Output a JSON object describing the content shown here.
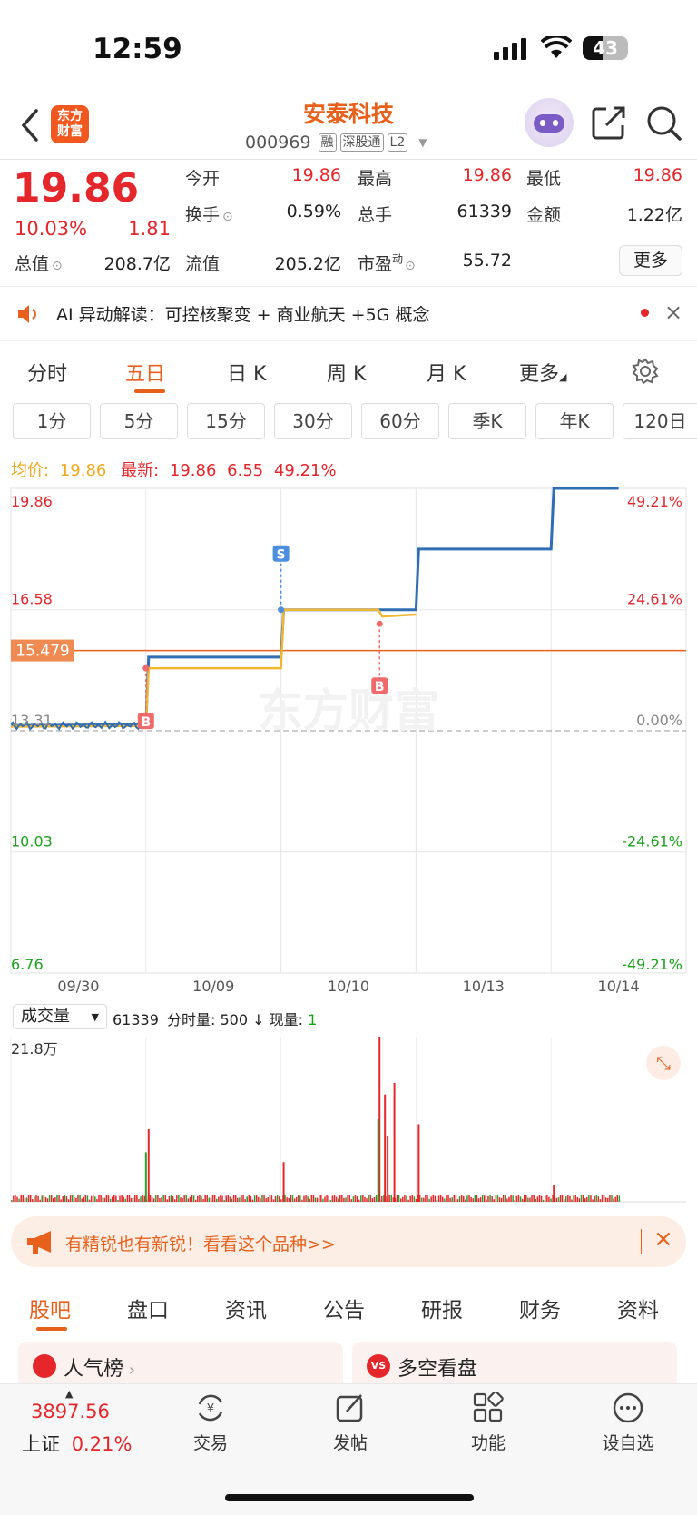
{
  "status_bar": {
    "time": "12:59",
    "battery": "43"
  },
  "header": {
    "logo_line1": "东方",
    "logo_line2": "财富",
    "title": "安泰科技",
    "code": "000969",
    "tags": [
      "融",
      "深股通",
      "L2"
    ]
  },
  "quote": {
    "price": "19.86",
    "change_pct": "10.03%",
    "change": "1.81",
    "fields": [
      {
        "label": "今开",
        "value": "19.86"
      },
      {
        "label": "最高",
        "value": "19.86"
      },
      {
        "label": "最低",
        "value": "19.86"
      },
      {
        "label": "换手",
        "value": "0.59%"
      },
      {
        "label": "总手",
        "value": "61339"
      },
      {
        "label": "金额",
        "value": "1.22亿"
      },
      {
        "label": "总值",
        "value": "208.7亿"
      },
      {
        "label": "流值",
        "value": "205.2亿"
      },
      {
        "label": "市盈",
        "sup": "动",
        "value": "55.72"
      }
    ],
    "more_button": "更多"
  },
  "ai_bar": {
    "text": "AI 异动解读：可控核聚变 + 商业航天 +5G 概念"
  },
  "period_tabs": [
    "分时",
    "五日",
    "日 K",
    "周 K",
    "月 K",
    "更多"
  ],
  "active_period": "五日",
  "sub_tabs": [
    "1分",
    "5分",
    "15分",
    "30分",
    "60分",
    "季K",
    "年K",
    "120日"
  ],
  "chart_info": {
    "avg_label": "均价:",
    "avg_value": "19.86",
    "latest_label": "最新:",
    "latest_price": "19.86",
    "latest_change": "6.55",
    "latest_pct": "49.21%"
  },
  "chart_data": {
    "type": "line",
    "title": "",
    "x": [
      "09/30",
      "10/09",
      "10/10",
      "10/13",
      "10/14"
    ],
    "y_left_ticks": [
      "19.86",
      "16.58",
      "13.31",
      "10.03",
      "6.76"
    ],
    "y_right_ticks": [
      "49.21%",
      "24.61%",
      "0.00%",
      "-24.61%",
      "-49.21%"
    ],
    "ylim": [
      6.76,
      19.86
    ],
    "reference_price": 13.31,
    "marker_line": {
      "label": "15.479",
      "value": 15.479
    },
    "series": [
      {
        "name": "价格",
        "color": "#2f6db5",
        "values": [
          [
            0,
            13.45
          ],
          [
            1,
            13.48
          ],
          [
            1.02,
            15.3
          ],
          [
            2,
            15.3
          ],
          [
            2.02,
            16.58
          ],
          [
            3,
            16.58
          ],
          [
            3.02,
            18.22
          ],
          [
            4,
            18.22
          ],
          [
            4.02,
            19.86
          ],
          [
            4.5,
            19.86
          ]
        ]
      },
      {
        "name": "均价",
        "color": "#f2b731",
        "values": [
          [
            0,
            13.42
          ],
          [
            1,
            13.44
          ],
          [
            1.02,
            15.0
          ],
          [
            2,
            15.0
          ],
          [
            2.02,
            16.58
          ],
          [
            2.72,
            16.58
          ],
          [
            2.75,
            16.4
          ],
          [
            3,
            16.45
          ]
        ]
      }
    ],
    "trade_markers": [
      {
        "label": "B",
        "day": 1.0,
        "price": 15.0
      },
      {
        "label": "S",
        "day": 2.0,
        "price": 16.58
      },
      {
        "label": "B",
        "day": 2.73,
        "price": 16.2
      }
    ],
    "grid": true
  },
  "volume": {
    "selector": "成交量",
    "total": "61339",
    "minute_label": "分时量:",
    "minute_value": "500",
    "arrow": "↓",
    "now_label": "现量:",
    "now_value": "1",
    "max_label": "21.8万"
  },
  "banner": {
    "text": "有精锐也有新锐！看看这个品种>>"
  },
  "content_tabs": [
    "股吧",
    "盘口",
    "资讯",
    "公告",
    "研报",
    "财务",
    "资料"
  ],
  "active_content_tab": "股吧",
  "cards": [
    {
      "title": "人气榜"
    },
    {
      "title": "多空看盘"
    }
  ],
  "bottom_nav": {
    "index_value": "3897.56",
    "index_name": "上证",
    "index_pct": "0.21%",
    "items": [
      "交易",
      "发帖",
      "功能",
      "设自选"
    ]
  },
  "colors": {
    "accent": "#e8611c",
    "up": "#e5262b",
    "down": "#1aa31a",
    "price_line": "#2f6db5",
    "avg_line": "#f2b731",
    "marker_line": "#e8611c"
  }
}
